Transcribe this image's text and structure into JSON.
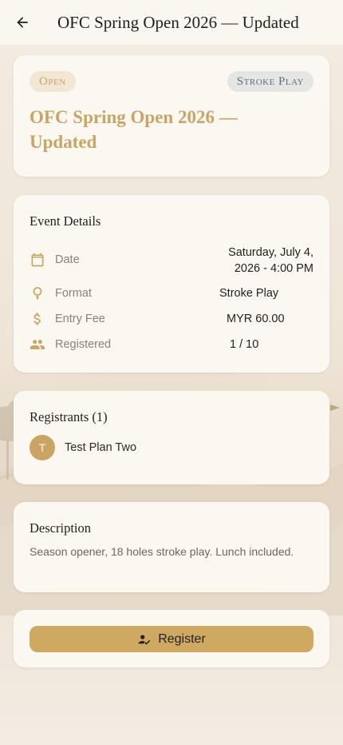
{
  "appbar": {
    "title": "OFC Spring Open 2026 — Updated",
    "back_icon": "arrow-back-icon"
  },
  "hero": {
    "status_chip": "Open",
    "type_chip": "Stroke Play",
    "title": "OFC Spring Open 2026 — Updated"
  },
  "details": {
    "heading": "Event Details",
    "rows": [
      {
        "icon": "calendar-icon",
        "label": "Date",
        "value_line1": "Saturday, July 4,",
        "value_line2": "2026 - 4:00 PM"
      },
      {
        "icon": "golf-tee-icon",
        "label": "Format",
        "value": "Stroke Play"
      },
      {
        "icon": "dollar-icon",
        "label": "Entry Fee",
        "value": "MYR 60.00"
      },
      {
        "icon": "people-icon",
        "label": "Registered",
        "value": "1 / 10"
      }
    ]
  },
  "registrants": {
    "heading": "Registrants (1)",
    "items": [
      {
        "initial": "T",
        "name": "Test Plan Two"
      }
    ]
  },
  "description": {
    "heading": "Description",
    "text": "Season opener, 18 holes stroke play. Lunch included."
  },
  "actions": {
    "register_label": "Register",
    "register_icon": "person-check-icon"
  },
  "colors": {
    "accent": "#c9a464",
    "button": "#cfa962",
    "background": "#f3ebe0",
    "card": "#fbf8f2"
  }
}
